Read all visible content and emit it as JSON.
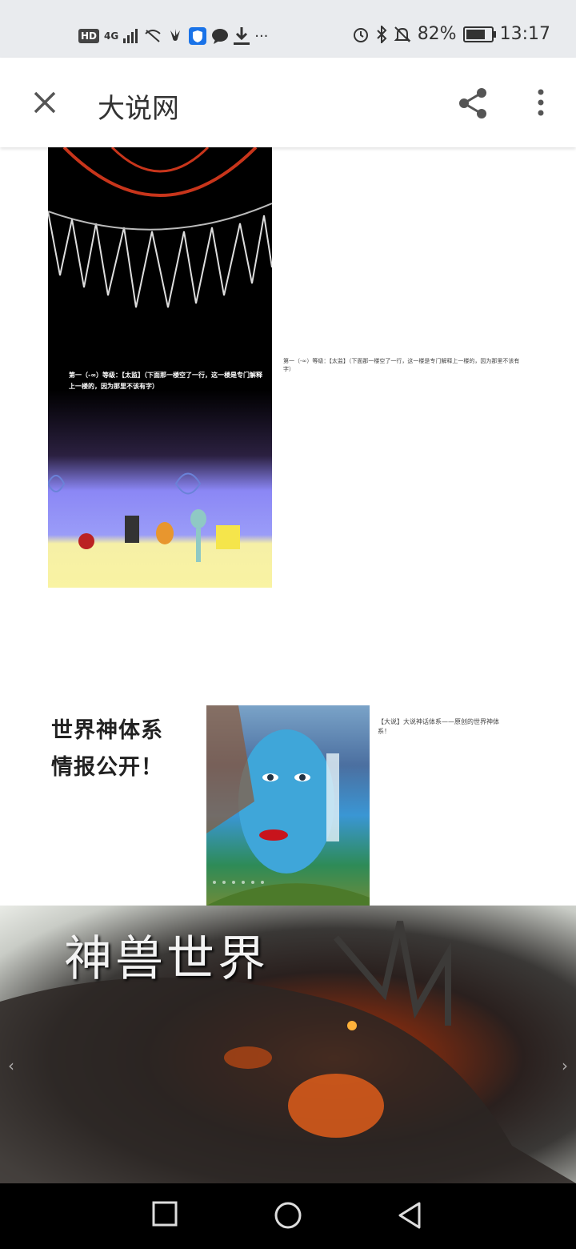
{
  "status_bar": {
    "hd": "HD",
    "signal": "4G",
    "battery_pct": "82%",
    "battery_level": 0.82,
    "time": "13:17",
    "icons_left": [
      "hd-icon",
      "signal-icon",
      "wifi-off-icon",
      "huawei-icon",
      "shield-app-icon",
      "chat-icon",
      "download-icon",
      "more-dots-icon"
    ],
    "icons_right": [
      "alarm-icon",
      "bluetooth-icon",
      "mute-icon",
      "battery-icon"
    ]
  },
  "app_bar": {
    "title": "大说网"
  },
  "content": {
    "image1_text": "第一（-∞）等级：【太监】（下面那一楼空了一行，这一楼是专门解释上一楼的，因为那里不该有字）",
    "caption1": "第一（-∞）等级：【太监】（下面那一楼空了一行，这一楼是专门解释上一楼的，因为那里不该有字）",
    "block2_line1": "世界神体系",
    "block2_line2": "情报公开！",
    "caption2": "【大说】大说神话体系——原创的世界神体系！",
    "dragon_title": "神兽世界",
    "prev_arrow": "‹",
    "next_arrow": "›"
  },
  "nav_bar": {
    "buttons": [
      "recents-button",
      "home-button",
      "back-button"
    ]
  }
}
